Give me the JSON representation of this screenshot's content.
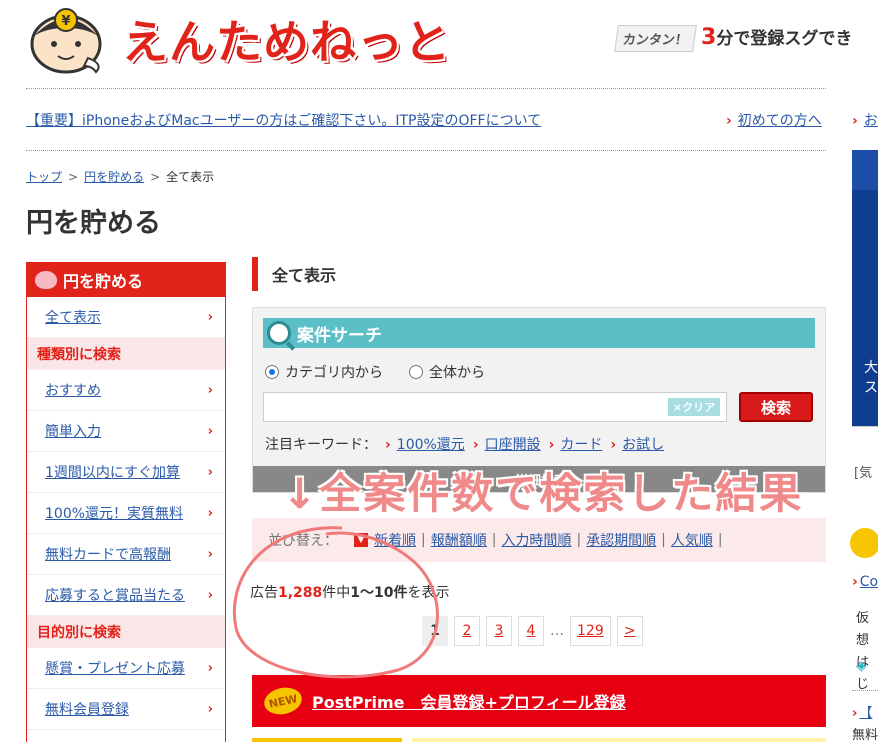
{
  "header": {
    "logo_text": "えんためねっと",
    "tagline_kantan": "カンタン！",
    "tagline_three": "3",
    "tagline_rest": "分で登録スグでき"
  },
  "notice": {
    "important_link": "【重要】iPhoneおよびMacユーザーの方はご確認下さい。ITP設定のOFFについて",
    "first_time_link": "初めての方へ",
    "edge_link": "お"
  },
  "breadcrumb": [
    "トップ",
    "円を貯める",
    "全て表示"
  ],
  "page_title": "円を貯める",
  "sidebar": {
    "header": "円を貯める",
    "top_item": "全て表示",
    "section_type": "種類別に検索",
    "type_items": [
      "おすすめ",
      "簡単入力",
      "1週間以内にすぐ加算",
      "100%還元！実質無料",
      "無料カードで高報酬",
      "応募すると賞品当たる"
    ],
    "section_purpose": "目的別に検索",
    "purpose_items": [
      "懸賞・プレゼント応募",
      "無料会員登録"
    ]
  },
  "main": {
    "section_title": "全て表示",
    "search": {
      "title": "案件サーチ",
      "radio_category": "カテゴリ内から",
      "radio_all": "全体から",
      "input_value": "",
      "clear_label": "×クリア",
      "search_label": "検索",
      "keywords_label": "注目キーワード：",
      "keywords": [
        "100%還元",
        "口座開設",
        "カード",
        "お試し"
      ],
      "detail_label": "詳細検索"
    },
    "sort": {
      "label": "並び替え：",
      "options": [
        "新着順",
        "報酬額順",
        "入力時間順",
        "承認期間順",
        "人気順"
      ]
    },
    "count": {
      "prefix": "広告",
      "total": "1,288",
      "mid": "件中",
      "range": "1〜10件",
      "suffix": "を表示"
    },
    "pagination": {
      "pages": [
        "1",
        "2",
        "3",
        "4"
      ],
      "dots": "…",
      "last": "129",
      "next": ">"
    },
    "promo": {
      "badge": "NEW",
      "title": "PostPrime　会員登録+プロフィール登録"
    }
  },
  "annotation": "↓全案件数で検索した結果",
  "right_column": {
    "banner_text": "大\nス",
    "banner_note": "※",
    "small_text": "[気",
    "link": "Co",
    "text_lines": [
      "仮想",
      "はじ"
    ],
    "link2": "【",
    "text2": "無料"
  },
  "colors": {
    "brand_red": "#e2231a",
    "search_teal": "#5bbfc7",
    "link_blue": "#2a5aa8",
    "annotation_pink": "#f08a8a"
  }
}
